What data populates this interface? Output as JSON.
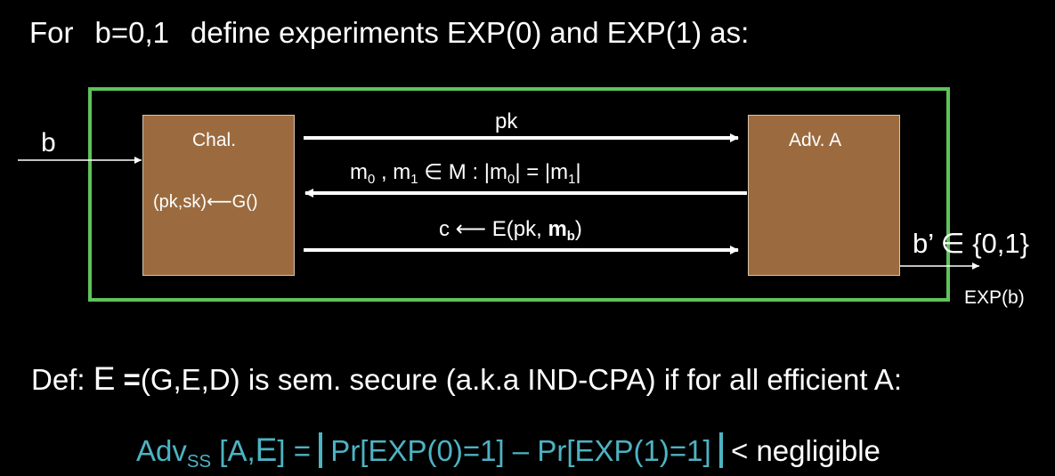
{
  "intro": {
    "lead": "For",
    "vars": "b=0,1",
    "rest": "define experiments EXP(0) and EXP(1) as:"
  },
  "challenger": {
    "title": "Chal.",
    "keygen": "(pk,sk)⟵G()"
  },
  "adversary": {
    "title": "Adv. A"
  },
  "messages": {
    "pk": "pk",
    "m_part1": "m",
    "m_sub0": "0",
    "m_part2": " , m",
    "m_sub1": "1",
    "m_part3": " ∈ M :   |m",
    "m_sub2": "0",
    "m_part4": "| = |m",
    "m_sub3": "1",
    "m_part5": "|",
    "c_part1": "c ⟵ E(pk, ",
    "c_bold": "m",
    "c_sub": "b",
    "c_part2": ")"
  },
  "input_label": "b",
  "output_label": "b’ ∈ {0,1}",
  "experiment_label": "EXP(b)",
  "definition": {
    "prefix": "Def: ",
    "scheme": "E",
    "eq": " =",
    "rest": "(G,E,D) is sem. secure (a.k.a IND-CPA) if for all efficient  A:"
  },
  "advantage": {
    "adv": "Adv",
    "adv_sub": "SS",
    "bracket_open": " [A,",
    "scheme": "E",
    "bracket_close": "]  =  ",
    "expr": " Pr[EXP(0)=1] – Pr[EXP(1)=1] ",
    "lt": "   <  ",
    "negligible": "negligible"
  },
  "colors": {
    "background": "#000000",
    "frame": "#5fc35a",
    "box_fill": "#9b6b3f",
    "formula": "#4db3c3"
  }
}
